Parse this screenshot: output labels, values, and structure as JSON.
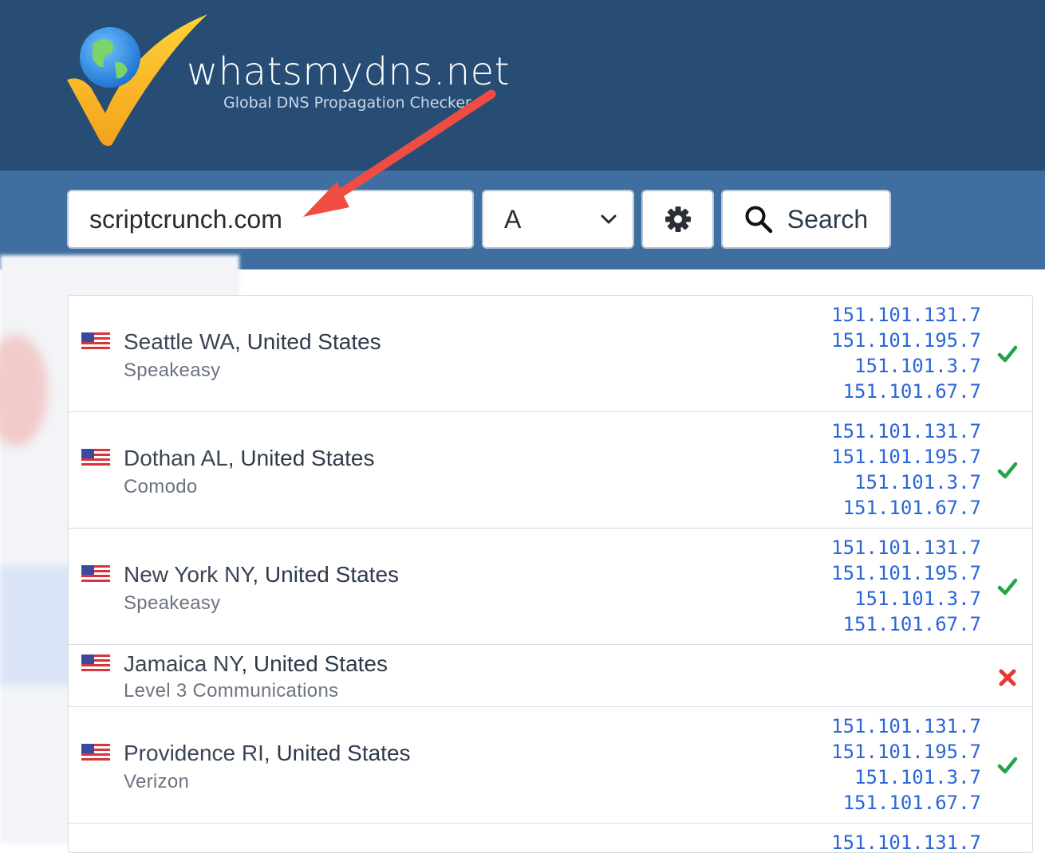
{
  "brand": {
    "name": "whatsmydns.net",
    "tagline": "Global DNS Propagation Checker"
  },
  "search": {
    "domain_value": "scriptcrunch.com",
    "record_type": "A",
    "search_label": "Search"
  },
  "colors": {
    "header_bg": "#284d75",
    "searchbar_bg": "#3f6fa0",
    "ip_link": "#2a66d6",
    "success": "#22a447",
    "failure": "#e53935",
    "annotation_arrow": "#ef4d43"
  },
  "icons": {
    "settings": "gear-icon",
    "search": "magnifier-icon",
    "dropdown": "chevron-down-icon",
    "ok": "checkmark-icon",
    "fail": "cross-icon",
    "flag": "us-flag-icon"
  },
  "results": [
    {
      "city": "Seattle WA",
      "country": "United States",
      "provider": "Speakeasy",
      "ips": [
        "151.101.131.7",
        "151.101.195.7",
        "151.101.3.7",
        "151.101.67.7"
      ],
      "status": "ok"
    },
    {
      "city": "Dothan AL",
      "country": "United States",
      "provider": "Comodo",
      "ips": [
        "151.101.131.7",
        "151.101.195.7",
        "151.101.3.7",
        "151.101.67.7"
      ],
      "status": "ok"
    },
    {
      "city": "New York NY",
      "country": "United States",
      "provider": "Speakeasy",
      "ips": [
        "151.101.131.7",
        "151.101.195.7",
        "151.101.3.7",
        "151.101.67.7"
      ],
      "status": "ok"
    },
    {
      "city": "Jamaica NY",
      "country": "United States",
      "provider": "Level 3 Communications",
      "ips": [],
      "status": "fail"
    },
    {
      "city": "Providence RI",
      "country": "United States",
      "provider": "Verizon",
      "ips": [
        "151.101.131.7",
        "151.101.195.7",
        "151.101.3.7",
        "151.101.67.7"
      ],
      "status": "ok"
    },
    {
      "city": "",
      "country": "",
      "provider": "",
      "ips": [
        "151.101.131.7"
      ],
      "status": "partial"
    }
  ]
}
